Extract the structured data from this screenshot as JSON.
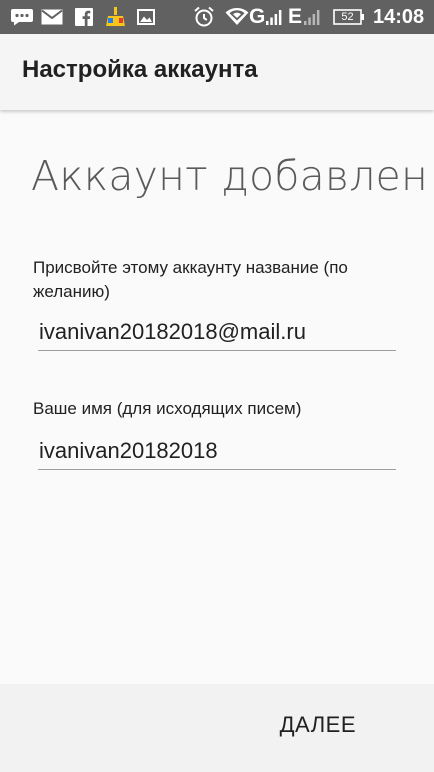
{
  "status_bar": {
    "time": "14:08",
    "battery_level": "52",
    "network_g": "G",
    "network_e": "E",
    "icons": [
      "chat-icon",
      "mail-icon",
      "facebook-icon",
      "cleaner-icon",
      "image-icon",
      "alarm-icon",
      "wifi-icon",
      "signal-icon",
      "battery-icon"
    ]
  },
  "app_bar": {
    "title": "Настройка аккаунта"
  },
  "content": {
    "headline": "Аккаунт добавлен!",
    "account_name_label": "Присвойте этому аккаунту название (по желанию)",
    "account_name_value": "ivanivan20182018@mail.ru",
    "your_name_label": "Ваше имя (для исходящих писем)",
    "your_name_value": "ivanivan20182018"
  },
  "bottom_bar": {
    "next_label": "ДАЛЕЕ"
  },
  "colors": {
    "status_bar": "#616161",
    "app_bar": "#f5f5f5",
    "background": "#fafafa",
    "text": "#212121",
    "headline": "#5a5a5a",
    "underline": "#9e9e9e"
  }
}
